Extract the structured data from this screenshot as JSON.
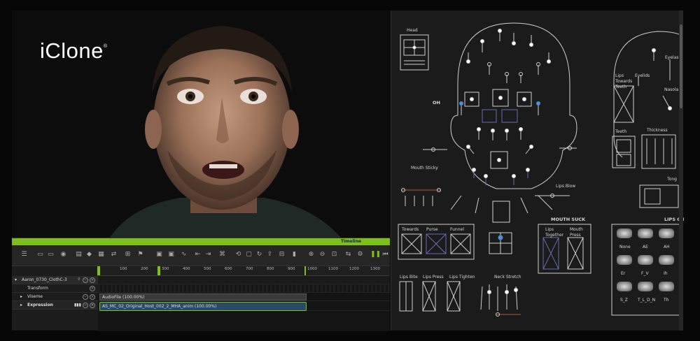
{
  "brand": {
    "name": "iClone",
    "mark": "®"
  },
  "timeline": {
    "header_title": "Timeline",
    "ruler_ticks": [
      "100",
      "200",
      "300",
      "400",
      "500",
      "600",
      "700",
      "800",
      "900",
      "1000",
      "1100",
      "1200",
      "1300"
    ],
    "tracks": [
      {
        "label": "Aaron_0730_ClothC-3"
      },
      {
        "label": "Transform"
      },
      {
        "label": "Viseme"
      },
      {
        "label": "Expression"
      }
    ],
    "clips": {
      "audio": "AudioFile (100.00%)",
      "expression": "AS_MC_02_Original_Host_002_2_MHA_anim (100.00%)"
    }
  },
  "rig": {
    "labels": {
      "head": "Head",
      "oh": "OH",
      "mouth_sticky": "Mouth Sticky",
      "lips_blow": "Lips Blow",
      "mouth_suck": "MOUTH SUCK",
      "towards": "Towards",
      "purse": "Purse",
      "funnel": "Funnel",
      "lips_together": "Lips Together",
      "mouth_press": "Mouth Press",
      "lips_bite": "Lips Bite",
      "lips_press": "Lips Press",
      "lips_tighten": "Lips Tighten",
      "neck_stretch": "Neck Stretch",
      "lips_towards_teeth": "Lips Towards Teeth",
      "eyelids": "Eyelids",
      "eyelashes": "Eyelas",
      "nasolabial": "Nasola",
      "teeth": "Teeth",
      "thickness": "Thickness",
      "tongue": "Tong",
      "lips_ch": "LIPS CH"
    },
    "visemes": [
      "None",
      "AE",
      "AH",
      "Er",
      "F_V",
      "Ih",
      "S_Z",
      "T_L_D_N",
      "Th"
    ]
  },
  "colors": {
    "accent": "#7cc01a",
    "clip_blue": "#2a4a66",
    "control_blue": "#4d8ed6"
  }
}
